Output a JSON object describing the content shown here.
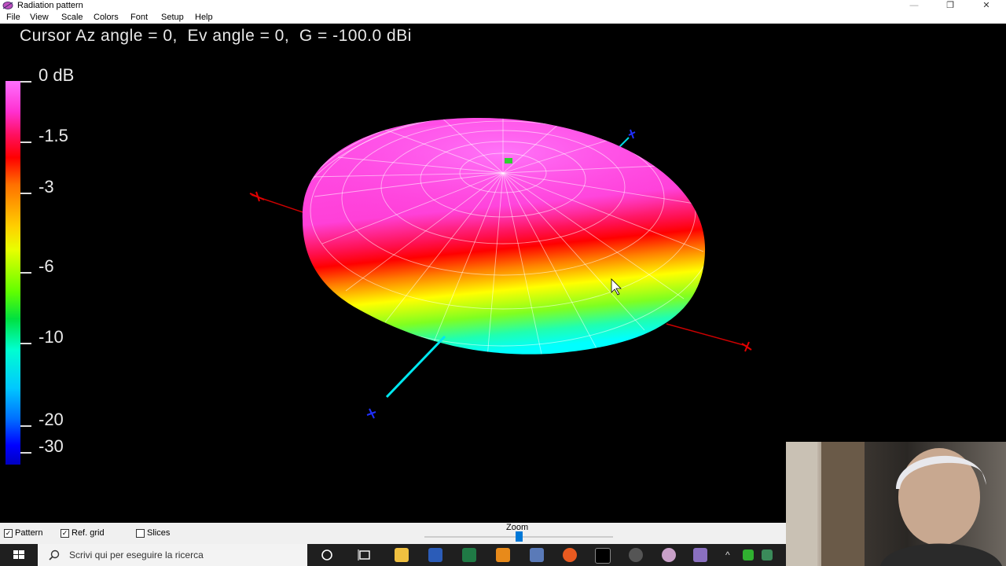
{
  "window": {
    "title": "Radiation pattern",
    "controls": {
      "minimize": "—",
      "maximize": "❐",
      "close": "✕"
    }
  },
  "menu": [
    "File",
    "View",
    "Scale",
    "Colors",
    "Font",
    "Setup",
    "Help"
  ],
  "readout": {
    "text": "Cursor Az angle = 0,  Ev angle = 0,  G = -100.0 dBi"
  },
  "legend": {
    "labels": [
      "0 dB",
      "-1.5",
      "-3",
      "-6",
      "-10",
      "-20",
      "-30"
    ]
  },
  "plot": {
    "axis_colors": {
      "x": "#e00000",
      "y": "#00e0e0",
      "z": "#2030ff"
    },
    "pattern_max_color": "#ff40e0",
    "pattern_mid_color": "#ff0000",
    "pattern_low_color": "#00ffff"
  },
  "controls": {
    "pattern": {
      "label": "Pattern",
      "checked": true
    },
    "ref_grid": {
      "label": "Ref. grid",
      "checked": true
    },
    "slices": {
      "label": "Slices",
      "checked": false
    },
    "zoom_label": "Zoom",
    "zoom_level": 0.5
  },
  "taskbar": {
    "search_placeholder": "Scrivi qui per eseguire la ricerca",
    "icons": [
      "cortana-icon",
      "task-view-icon",
      "file-explorer-icon",
      "word-icon",
      "excel-icon",
      "outlook-icon",
      "calculator-icon",
      "firefox-icon",
      "terminal-icon",
      "app-icon-1",
      "app-icon-2",
      "app-icon-3"
    ]
  }
}
